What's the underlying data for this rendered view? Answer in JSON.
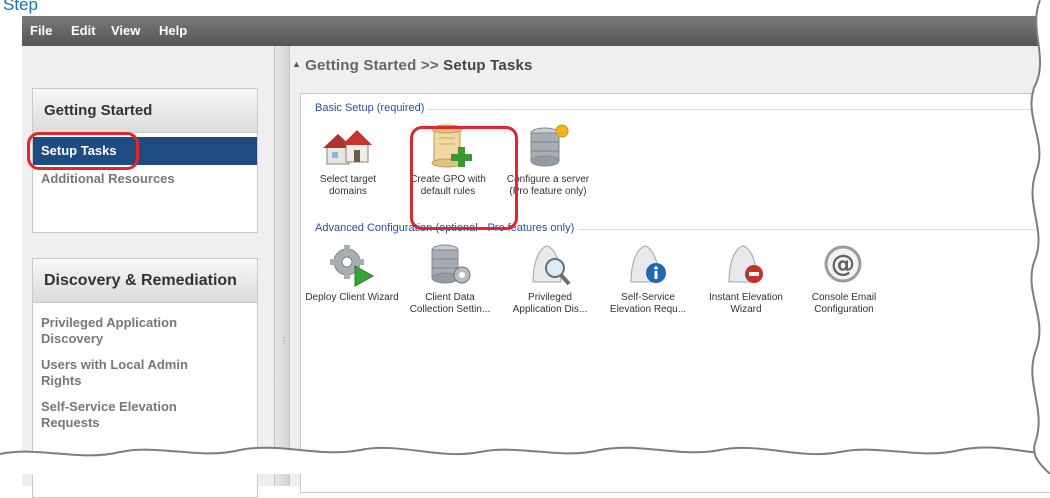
{
  "caption_fragment": "Step",
  "menu": {
    "file": "File",
    "edit": "Edit",
    "view": "View",
    "help": "Help"
  },
  "left": {
    "getting_started": {
      "header": "Getting Started",
      "items": [
        "Setup Tasks",
        "Additional Resources"
      ],
      "selected": "Setup Tasks"
    },
    "discovery": {
      "header": "Discovery & Remediation",
      "items": [
        "Privileged Application Discovery",
        "Users with Local Admin Rights",
        "Self-Service Elevation Requests"
      ]
    }
  },
  "breadcrumb": {
    "parent": "Getting Started",
    "separator": ">>",
    "current": "Setup Tasks"
  },
  "sections": {
    "basic": {
      "title": "Basic Setup (required)",
      "tiles": [
        {
          "label": "Select target domains",
          "icon": "houses-icon"
        },
        {
          "label": "Create GPO with default rules",
          "icon": "scroll-add-icon"
        },
        {
          "label": "Configure a server (Pro feature only)",
          "icon": "database-server-icon"
        }
      ]
    },
    "advanced": {
      "title": "Advanced Configuration (optional - Pro features only)",
      "tiles": [
        {
          "label": "Deploy Client Wizard",
          "icon": "gear-play-icon"
        },
        {
          "label": "Client Data Collection Settin...",
          "icon": "database-gear-icon"
        },
        {
          "label": "Privileged Application Dis...",
          "icon": "magnifier-icon"
        },
        {
          "label": "Self-Service Elevation Requ...",
          "icon": "info-magnifier-icon"
        },
        {
          "label": "Instant Elevation Wizard",
          "icon": "wizard-magnifier-icon"
        },
        {
          "label": "Console Email Configuration",
          "icon": "at-sign-icon"
        }
      ]
    }
  },
  "colors": {
    "highlight": "#e0262f",
    "selected": "#1e4b80",
    "section_title": "#2a4fa6",
    "menubar": "#555555"
  }
}
